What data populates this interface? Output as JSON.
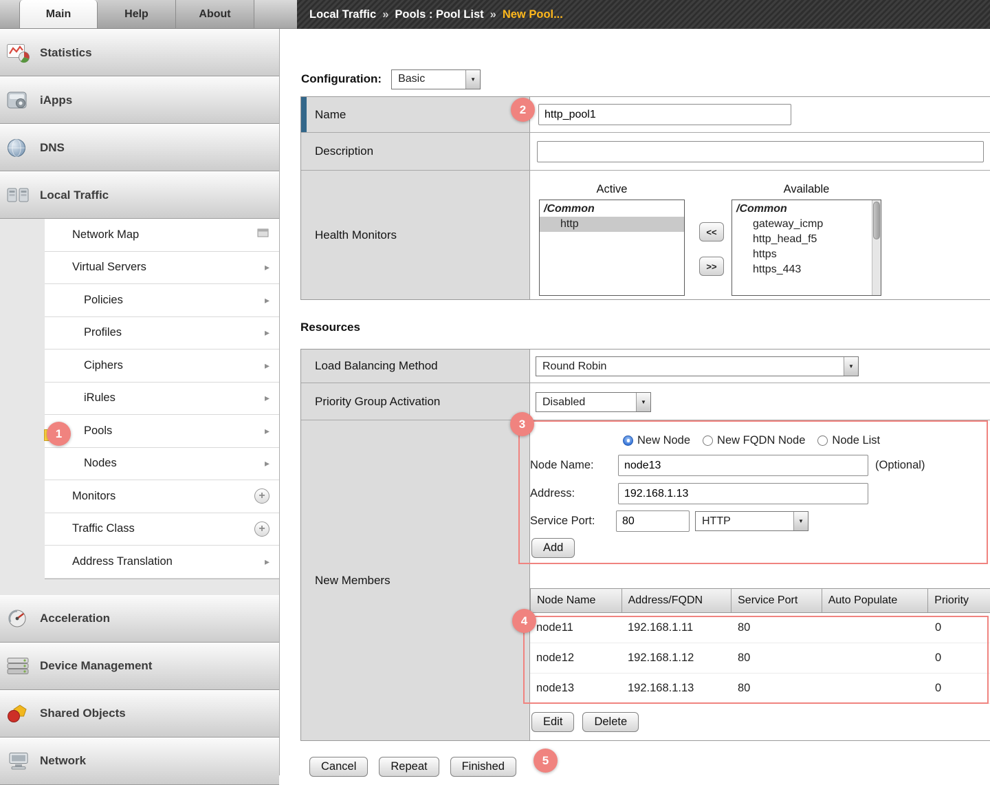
{
  "tabs": {
    "main": "Main",
    "help": "Help",
    "about": "About"
  },
  "breadcrumb": {
    "section": "Local Traffic",
    "separator": "»",
    "page": "Pools : Pool List",
    "current": "New Pool..."
  },
  "icons": {
    "submenu_arrow": "▸",
    "plus": "+",
    "dropdown_arrow": "▼"
  },
  "sidebar": {
    "items": [
      {
        "label": "Statistics"
      },
      {
        "label": "iApps"
      },
      {
        "label": "DNS"
      },
      {
        "label": "Local Traffic"
      }
    ],
    "local_traffic_menu": [
      {
        "label": "Network Map"
      },
      {
        "label": "Virtual Servers"
      },
      {
        "label": "Policies"
      },
      {
        "label": "Profiles"
      },
      {
        "label": "Ciphers"
      },
      {
        "label": "iRules"
      },
      {
        "label": "Pools"
      },
      {
        "label": "Nodes"
      },
      {
        "label": "Monitors"
      },
      {
        "label": "Traffic Class"
      },
      {
        "label": "Address Translation"
      }
    ],
    "bottom_items": [
      {
        "label": "Acceleration"
      },
      {
        "label": "Device Management"
      },
      {
        "label": "Shared Objects"
      },
      {
        "label": "Network"
      }
    ]
  },
  "configuration": {
    "label": "Configuration:",
    "value": "Basic"
  },
  "form": {
    "name": {
      "label": "Name",
      "value": "http_pool1"
    },
    "description": {
      "label": "Description",
      "value": ""
    },
    "health_monitors": {
      "label": "Health Monitors",
      "active_header": "Active",
      "available_header": "Available",
      "active_group": "/Common",
      "active_items": [
        "http"
      ],
      "available_group": "/Common",
      "available_items": [
        "gateway_icmp",
        "http_head_f5",
        "https",
        "https_443"
      ],
      "move_left_button": "<<",
      "move_right_button": ">>"
    }
  },
  "resources": {
    "title": "Resources",
    "load_balancing": {
      "label": "Load Balancing Method",
      "value": "Round Robin"
    },
    "priority_group": {
      "label": "Priority Group Activation",
      "value": "Disabled"
    },
    "new_members": {
      "label": "New Members",
      "radio_new_node": "New Node",
      "radio_new_fqdn": "New FQDN Node",
      "radio_node_list": "Node List",
      "node_name_label": "Node Name:",
      "node_name_value": "node13",
      "optional_note": "(Optional)",
      "address_label": "Address:",
      "address_value": "192.168.1.13",
      "service_port_label": "Service Port:",
      "service_port_value": "80",
      "service_type_value": "HTTP",
      "add_button": "Add",
      "table": {
        "headers": [
          "Node Name",
          "Address/FQDN",
          "Service Port",
          "Auto Populate",
          "Priority"
        ],
        "rows": [
          {
            "node_name": "node11",
            "address": "192.168.1.11",
            "port": "80",
            "auto_populate": "",
            "priority": "0"
          },
          {
            "node_name": "node12",
            "address": "192.168.1.12",
            "port": "80",
            "auto_populate": "",
            "priority": "0"
          },
          {
            "node_name": "node13",
            "address": "192.168.1.13",
            "port": "80",
            "auto_populate": "",
            "priority": "0"
          }
        ]
      },
      "edit_button": "Edit",
      "delete_button": "Delete"
    }
  },
  "footer": {
    "cancel": "Cancel",
    "repeat": "Repeat",
    "finished": "Finished"
  },
  "annotations": {
    "step1": "1",
    "step2": "2",
    "step3": "3",
    "step4": "4",
    "step5": "5"
  }
}
